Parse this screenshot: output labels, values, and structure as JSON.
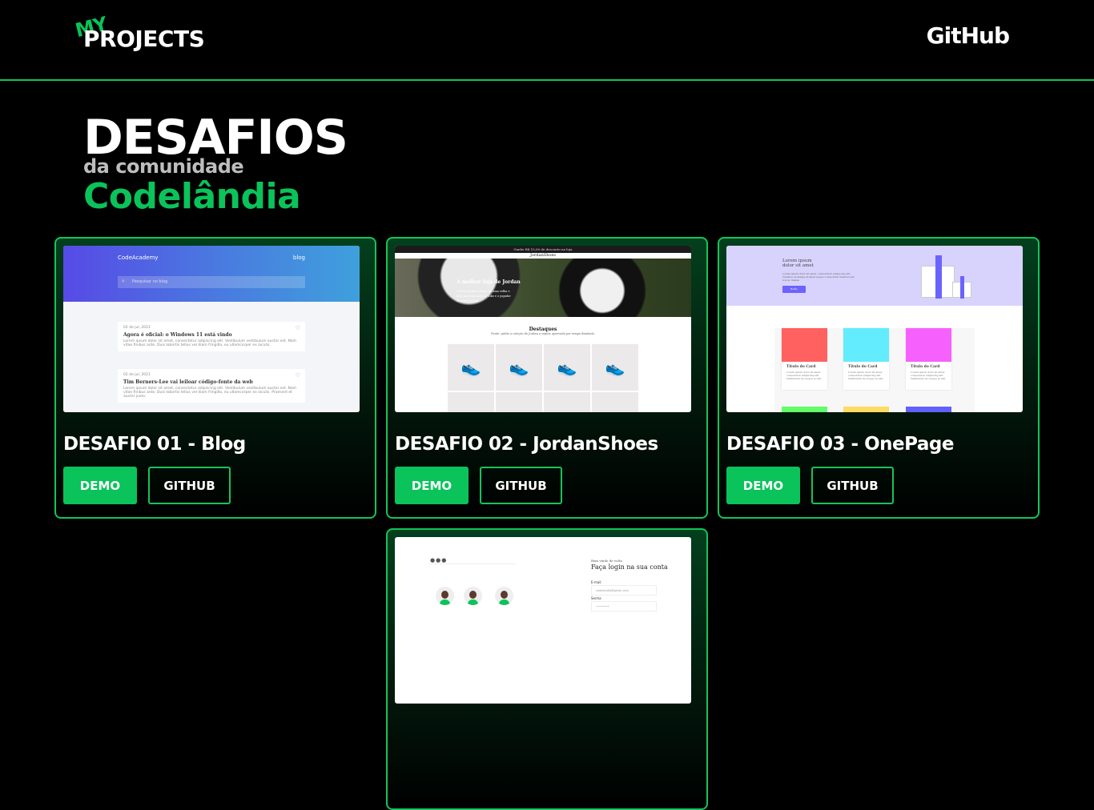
{
  "header": {
    "logo_top": "MY",
    "logo_main": "PROJECTS",
    "github_link": "GitHub"
  },
  "hero": {
    "title": "DESAFIOS",
    "subtitle": "da comunidade",
    "highlight": "Codelândia"
  },
  "colors": {
    "accent": "#0ac35a",
    "background": "#000000"
  },
  "projects": [
    {
      "title": "DESAFIO 01 - Blog",
      "demo": "DEMO",
      "github": "GITHUB",
      "thumb": {
        "brand": "CodeAcademy",
        "nav": "blog",
        "search": "Pesquisar no blog",
        "posts": [
          {
            "date": "02 de jul, 2021",
            "title": "Agora é oficial: o Windows 11 está vindo",
            "text": "Lorem ipsum dolor sit amet, consectetur adipiscing elit. Vestibulum vestibulum auctor est. Nam vitae finibus ante. Duis lobortis tellus vel diam fringilla, eu ullamcorper ex iaculis."
          },
          {
            "date": "02 de jul, 2021",
            "title": "Tim Berners-Lee vai leiloar código-fonte da web",
            "text": "Lorem ipsum dolor sit amet, consectetur adipiscing elit. Vestibulum vestibulum auctor est. Nam vitae finibus ante. Duis lobortis tellus vel diam fringilla, eu ullamcorper ex iaculis. Praesent et auctor justo."
          }
        ]
      }
    },
    {
      "title": "DESAFIO 02 - JordanShoes",
      "demo": "DEMO",
      "github": "GITHUB",
      "thumb": {
        "topbar": "Ganhe R$ 15,00 de desconto na loja",
        "brand": "JordanShoes",
        "hero_title": "A melhor loja de Jordan",
        "hero_text": "O tênis Jordan é fruto de uma velha e bela parceria entre a Nike e o jogador Michael Jordan.",
        "section": "Destaques",
        "section_sub": "Fonte: grátis a coleção de Jordan a seguir, aprovada por tempo ilimitado."
      }
    },
    {
      "title": "DESAFIO 03 - OnePage",
      "demo": "DEMO",
      "github": "GITHUB",
      "thumb": {
        "hero_title": "Lorem ipsum dolor sit amet",
        "hero_text": "Lorem ipsum dolor sit amet, consectetur adipiscing elit. Vivamus eu massa sit amet augue consectetur ullamcorper non ac massa.",
        "hero_button": "Botão",
        "card_title": "Título do Card",
        "card_text": "Lorem ipsum dolor sit amet, consectetur adipiscing elit. Vestibulum leo neque et nisl."
      }
    },
    {
      "thumb": {
        "welcome": "Bem vindo de volta",
        "heading": "Faça login na sua conta",
        "email_label": "E-mail",
        "email_value": "codelandia@gmail.com",
        "password_label": "Senha",
        "password_value": "••••••••"
      }
    }
  ]
}
